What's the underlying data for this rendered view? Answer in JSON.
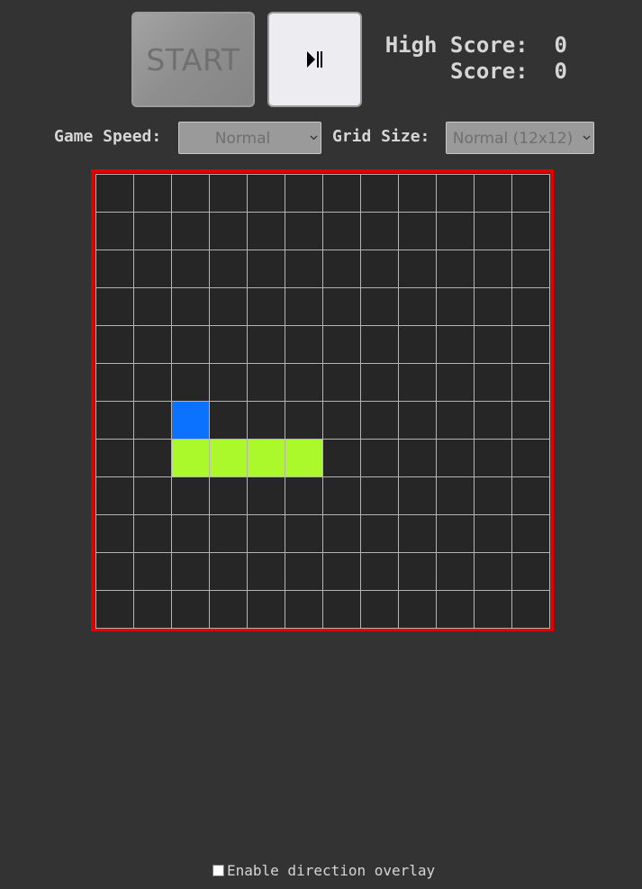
{
  "controls": {
    "start_label": "START",
    "pause_icon": "play-pause-icon"
  },
  "scores": {
    "high_label": "High Score:",
    "high_value": "0",
    "score_label": "Score:",
    "score_value": "0"
  },
  "settings": {
    "speed_label": "Game Speed:",
    "speed_value": "Normal",
    "grid_label": "Grid Size:",
    "grid_value": "Normal (12x12)"
  },
  "board": {
    "rows": 12,
    "cols": 12,
    "border_color": "#e00000",
    "food": {
      "row": 6,
      "col": 2,
      "color": "#0a72ff"
    },
    "snake": {
      "color": "#abf82b",
      "segments": [
        {
          "row": 7,
          "col": 2
        },
        {
          "row": 7,
          "col": 3
        },
        {
          "row": 7,
          "col": 4
        },
        {
          "row": 7,
          "col": 5
        }
      ]
    }
  },
  "overlay": {
    "label": "Enable direction overlay",
    "checked": false
  }
}
